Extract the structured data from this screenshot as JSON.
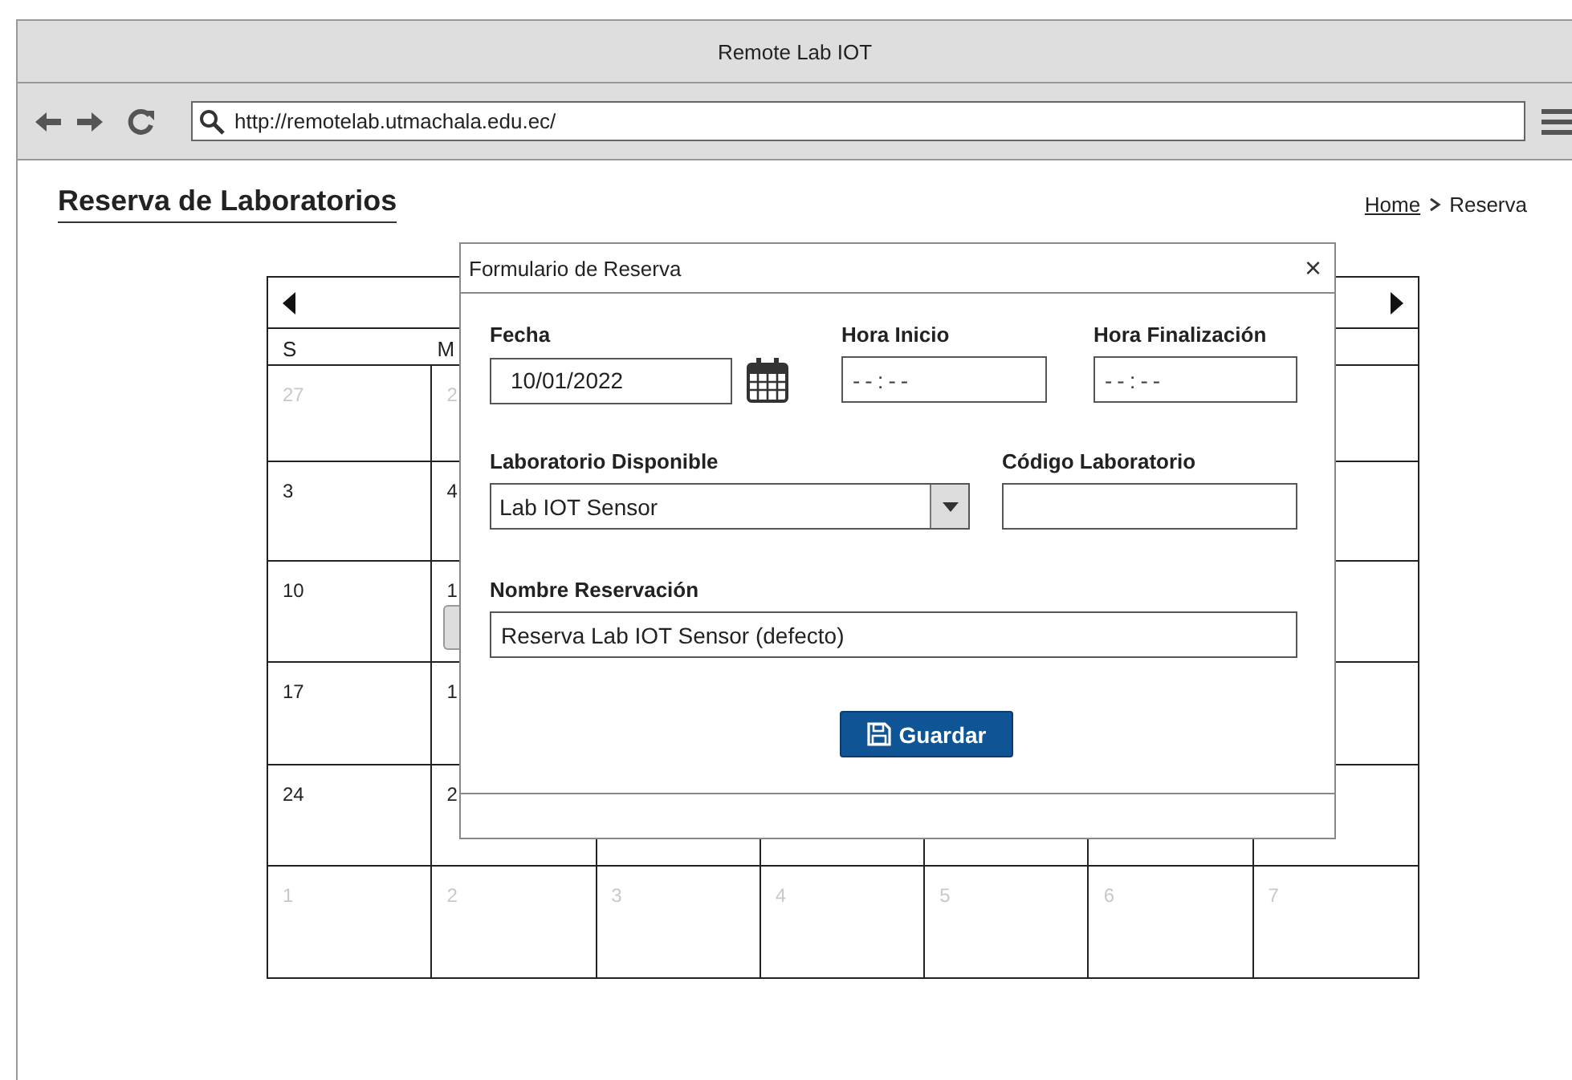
{
  "window": {
    "title": "Remote Lab IOT"
  },
  "toolbar": {
    "url": "http://remotelab.utmachala.edu.ec/"
  },
  "page": {
    "title": "Reserva de Laboratorios",
    "breadcrumb": [
      {
        "label": "Home",
        "kind": "link"
      },
      {
        "label": "Reserva",
        "kind": "current"
      }
    ]
  },
  "calendar": {
    "weekdays": [
      "S",
      "M"
    ],
    "weeks": [
      {
        "muted": true,
        "days": [
          {
            "day": "27"
          },
          {
            "day": "2"
          }
        ]
      },
      {
        "muted": false,
        "days": [
          {
            "day": "3"
          },
          {
            "day": "4"
          }
        ]
      },
      {
        "muted": false,
        "days": [
          {
            "day": "10"
          },
          {
            "day": "1",
            "event": true
          }
        ]
      },
      {
        "muted": false,
        "days": [
          {
            "day": "17"
          },
          {
            "day": "1"
          }
        ]
      },
      {
        "muted": false,
        "days": [
          {
            "day": "24"
          },
          {
            "day": "2"
          }
        ]
      },
      {
        "muted": true,
        "days": [
          {
            "day": "1"
          },
          {
            "day": "2"
          },
          {
            "day": "3"
          },
          {
            "day": "4"
          },
          {
            "day": "5"
          },
          {
            "day": "6"
          },
          {
            "day": "7"
          }
        ]
      }
    ]
  },
  "dialog": {
    "title": "Formulario de Reserva",
    "close": "×",
    "fecha": {
      "label": "Fecha",
      "value": "10/01/2022"
    },
    "hora_inicio": {
      "label": "Hora Inicio",
      "placeholder": "--:--"
    },
    "hora_finalizacion": {
      "label": "Hora Finalización",
      "placeholder": "--:--"
    },
    "laboratorio": {
      "label": "Laboratorio Disponible",
      "value": "Lab IOT Sensor"
    },
    "codigo": {
      "label": "Código Laboratorio"
    },
    "nombre": {
      "label": "Nombre Reservación",
      "value": "Reserva Lab IOT Sensor (defecto)"
    },
    "save_button": "Guardar"
  }
}
